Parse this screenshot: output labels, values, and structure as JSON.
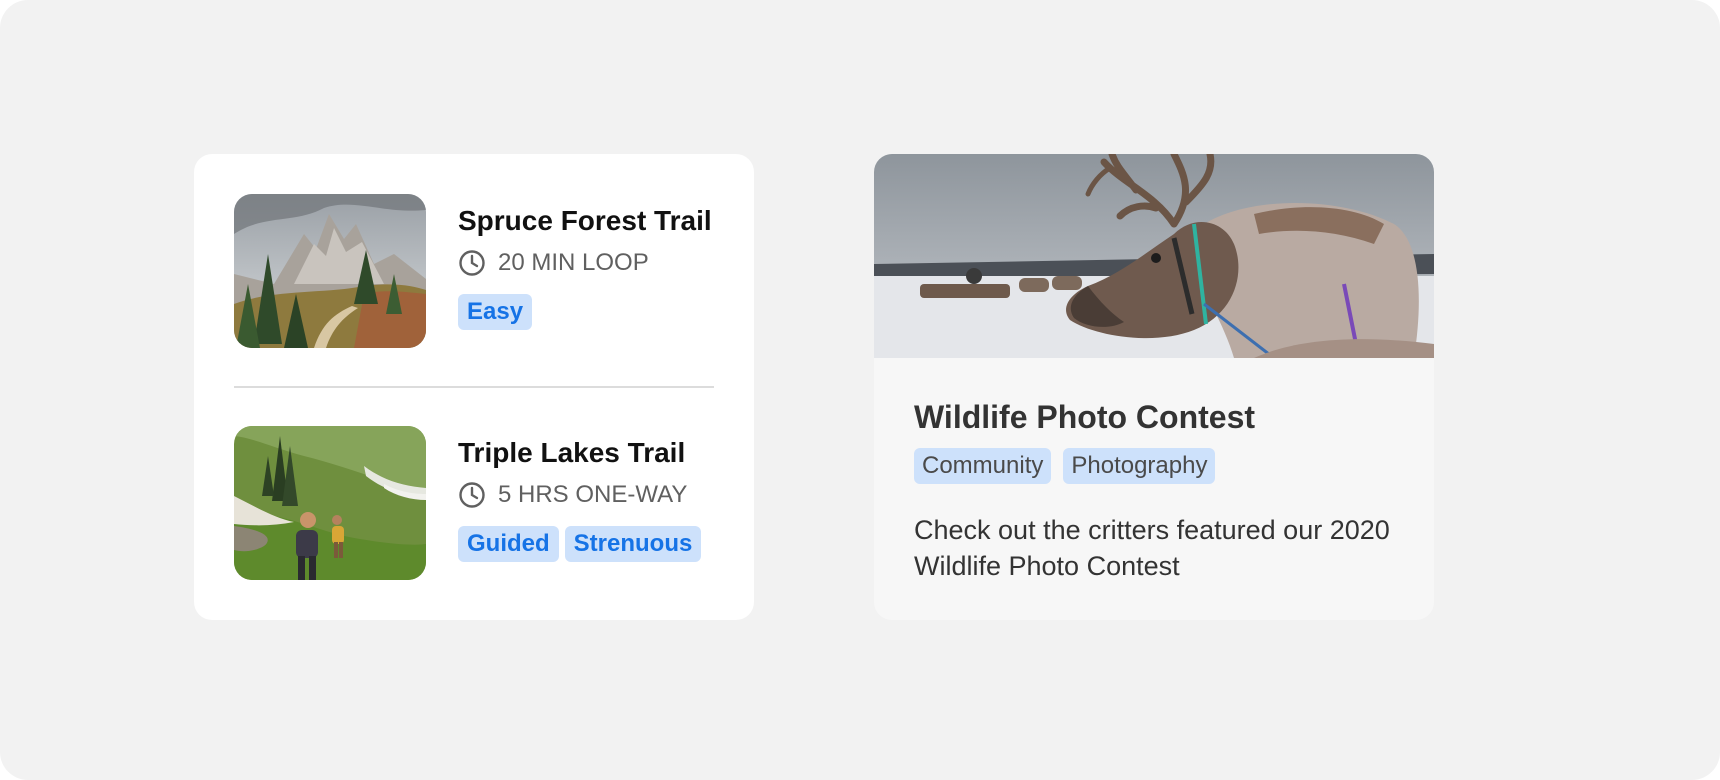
{
  "trails": [
    {
      "title": "Spruce Forest Trail",
      "image_icon": "mountain-forest-photo",
      "duration": "20 MIN LOOP",
      "duration_icon": "clock-icon",
      "tags": [
        "Easy"
      ]
    },
    {
      "title": "Triple Lakes Trail",
      "image_icon": "hikers-meadow-photo",
      "duration": "5 HRS ONE-WAY",
      "duration_icon": "clock-icon",
      "tags": [
        "Guided",
        "Strenuous"
      ]
    }
  ],
  "event": {
    "image_icon": "reindeer-photo",
    "title": "Wildlife Photo Contest",
    "tags": [
      "Community",
      "Photography"
    ],
    "description": "Check out the critters featured our 2020 Wildlife Photo Contest"
  },
  "colors": {
    "page_background": "#f2f2f2",
    "card_background": "#ffffff",
    "event_card_background": "#f7f7f7",
    "tag_background": "#cde1fb",
    "tag_text": "#1673e6",
    "meta_text": "#606060"
  }
}
